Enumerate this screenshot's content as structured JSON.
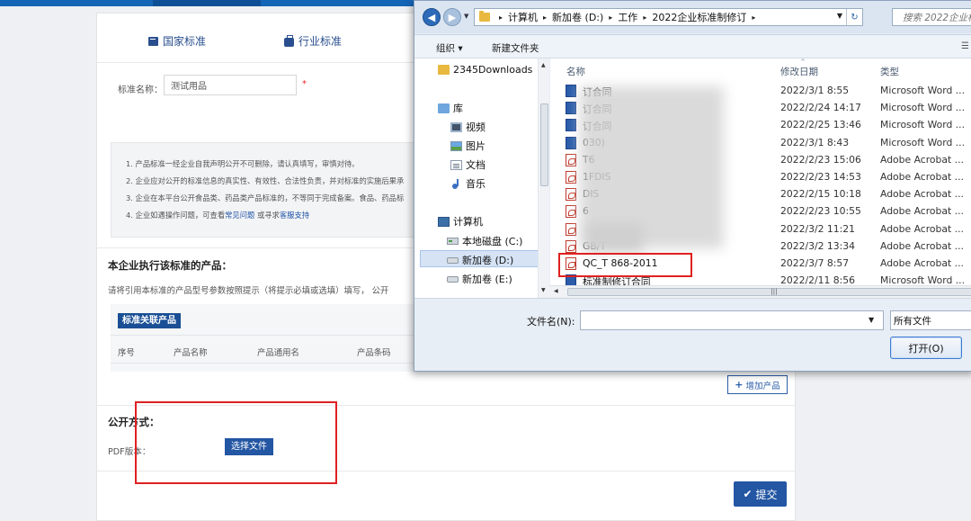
{
  "page": {
    "tabs": [
      "国家标准",
      "行业标准"
    ],
    "standard_name_label": "标准名称：",
    "standard_name_value": "测试用品",
    "required_mark": "*",
    "notices": [
      {
        "text": "1. 产品标准一经企业自我声明公开不可删除，请认真填写，审慎对待。"
      },
      {
        "text": "2. 企业应对公开的标准信息的真实性、有效性、合法性负责，并对标准的实施后果承"
      },
      {
        "text": "3. 企业在本平台公开食品类、药品类产品标准的，不等同于完成备案。食品、药品标"
      },
      {
        "pre": "4. 企业如遇操作问题，可查看",
        "link1": "常见问题",
        "mid": " 或寻求",
        "link2": "客服支持"
      }
    ],
    "products_title": "本企业执行该标准的产品：",
    "products_hint": "请将引用本标准的产品型号参数按照提示（将提示必填或选填）填写， 公开",
    "table_badge": "标准关联产品",
    "table_headers": [
      "序号",
      "产品名称",
      "产品通用名",
      "产品条码"
    ],
    "add_product_label": "增加产品",
    "disclosure_title": "公开方式：",
    "pdf_label": "PDF版本：",
    "choose_file_label": "选择文件",
    "submit_label": "提交"
  },
  "dialog": {
    "path": [
      "计算机",
      "新加卷 (D:)",
      "工作",
      "2022企业标准制修订"
    ],
    "search_placeholder": "搜索 2022企业标",
    "toolbar": {
      "organize": "组织 ▾",
      "new_folder": "新建文件夹"
    },
    "nav": [
      {
        "label": "2345Downloads",
        "icon": "folder-icon"
      },
      {
        "label": "库",
        "icon": "library-icon"
      },
      {
        "label": "视频",
        "icon": "video-icon"
      },
      {
        "label": "图片",
        "icon": "picture-icon"
      },
      {
        "label": "文档",
        "icon": "document-icon"
      },
      {
        "label": "音乐",
        "icon": "music-icon"
      },
      {
        "label": "计算机",
        "icon": "computer-icon"
      },
      {
        "label": "本地磁盘 (C:)",
        "icon": "local-disk-icon"
      },
      {
        "label": "新加卷 (D:)",
        "icon": "drive-icon"
      },
      {
        "label": "新加卷 (E:)",
        "icon": "drive-icon"
      }
    ],
    "columns": {
      "name": "名称",
      "date": "修改日期",
      "type": "类型"
    },
    "files": [
      {
        "name": "订合同",
        "date": "2022/3/1 8:55",
        "type": "Microsoft Word ...",
        "icon": "word"
      },
      {
        "name": "订合同",
        "date": "2022/2/24 14:17",
        "type": "Microsoft Word ...",
        "icon": "word"
      },
      {
        "name": "订合同",
        "date": "2022/2/25 13:46",
        "type": "Microsoft Word ...",
        "icon": "word"
      },
      {
        "name": "030)",
        "date": "2022/3/1 8:43",
        "type": "Microsoft Word ...",
        "icon": "word"
      },
      {
        "name": "T6",
        "date": "2022/2/23 15:06",
        "type": "Adobe Acrobat ...",
        "icon": "pdf"
      },
      {
        "name": "1FDIS",
        "date": "2022/2/23 14:53",
        "type": "Adobe Acrobat ...",
        "icon": "pdf"
      },
      {
        "name": "DIS",
        "date": "2022/2/15 10:18",
        "type": "Adobe Acrobat ...",
        "icon": "pdf"
      },
      {
        "name": "6",
        "date": "2022/2/23 10:55",
        "type": "Adobe Acrobat ...",
        "icon": "pdf"
      },
      {
        "name": "",
        "date": "2022/3/2 11:21",
        "type": "Adobe Acrobat ...",
        "icon": "pdf"
      },
      {
        "name": "GB/T",
        "date": "2022/3/2 13:34",
        "type": "Adobe Acrobat ...",
        "icon": "pdf"
      },
      {
        "name": "QC_T 868-2011",
        "date": "2022/3/7 8:57",
        "type": "Adobe Acrobat ...",
        "icon": "pdf"
      },
      {
        "name": "标准制修订合同",
        "date": "2022/2/11 8:56",
        "type": "Microsoft Word ...",
        "icon": "word"
      }
    ],
    "filename_label": "文件名(N):",
    "filetype_value": "所有文件",
    "open_label": "打开(O)"
  }
}
